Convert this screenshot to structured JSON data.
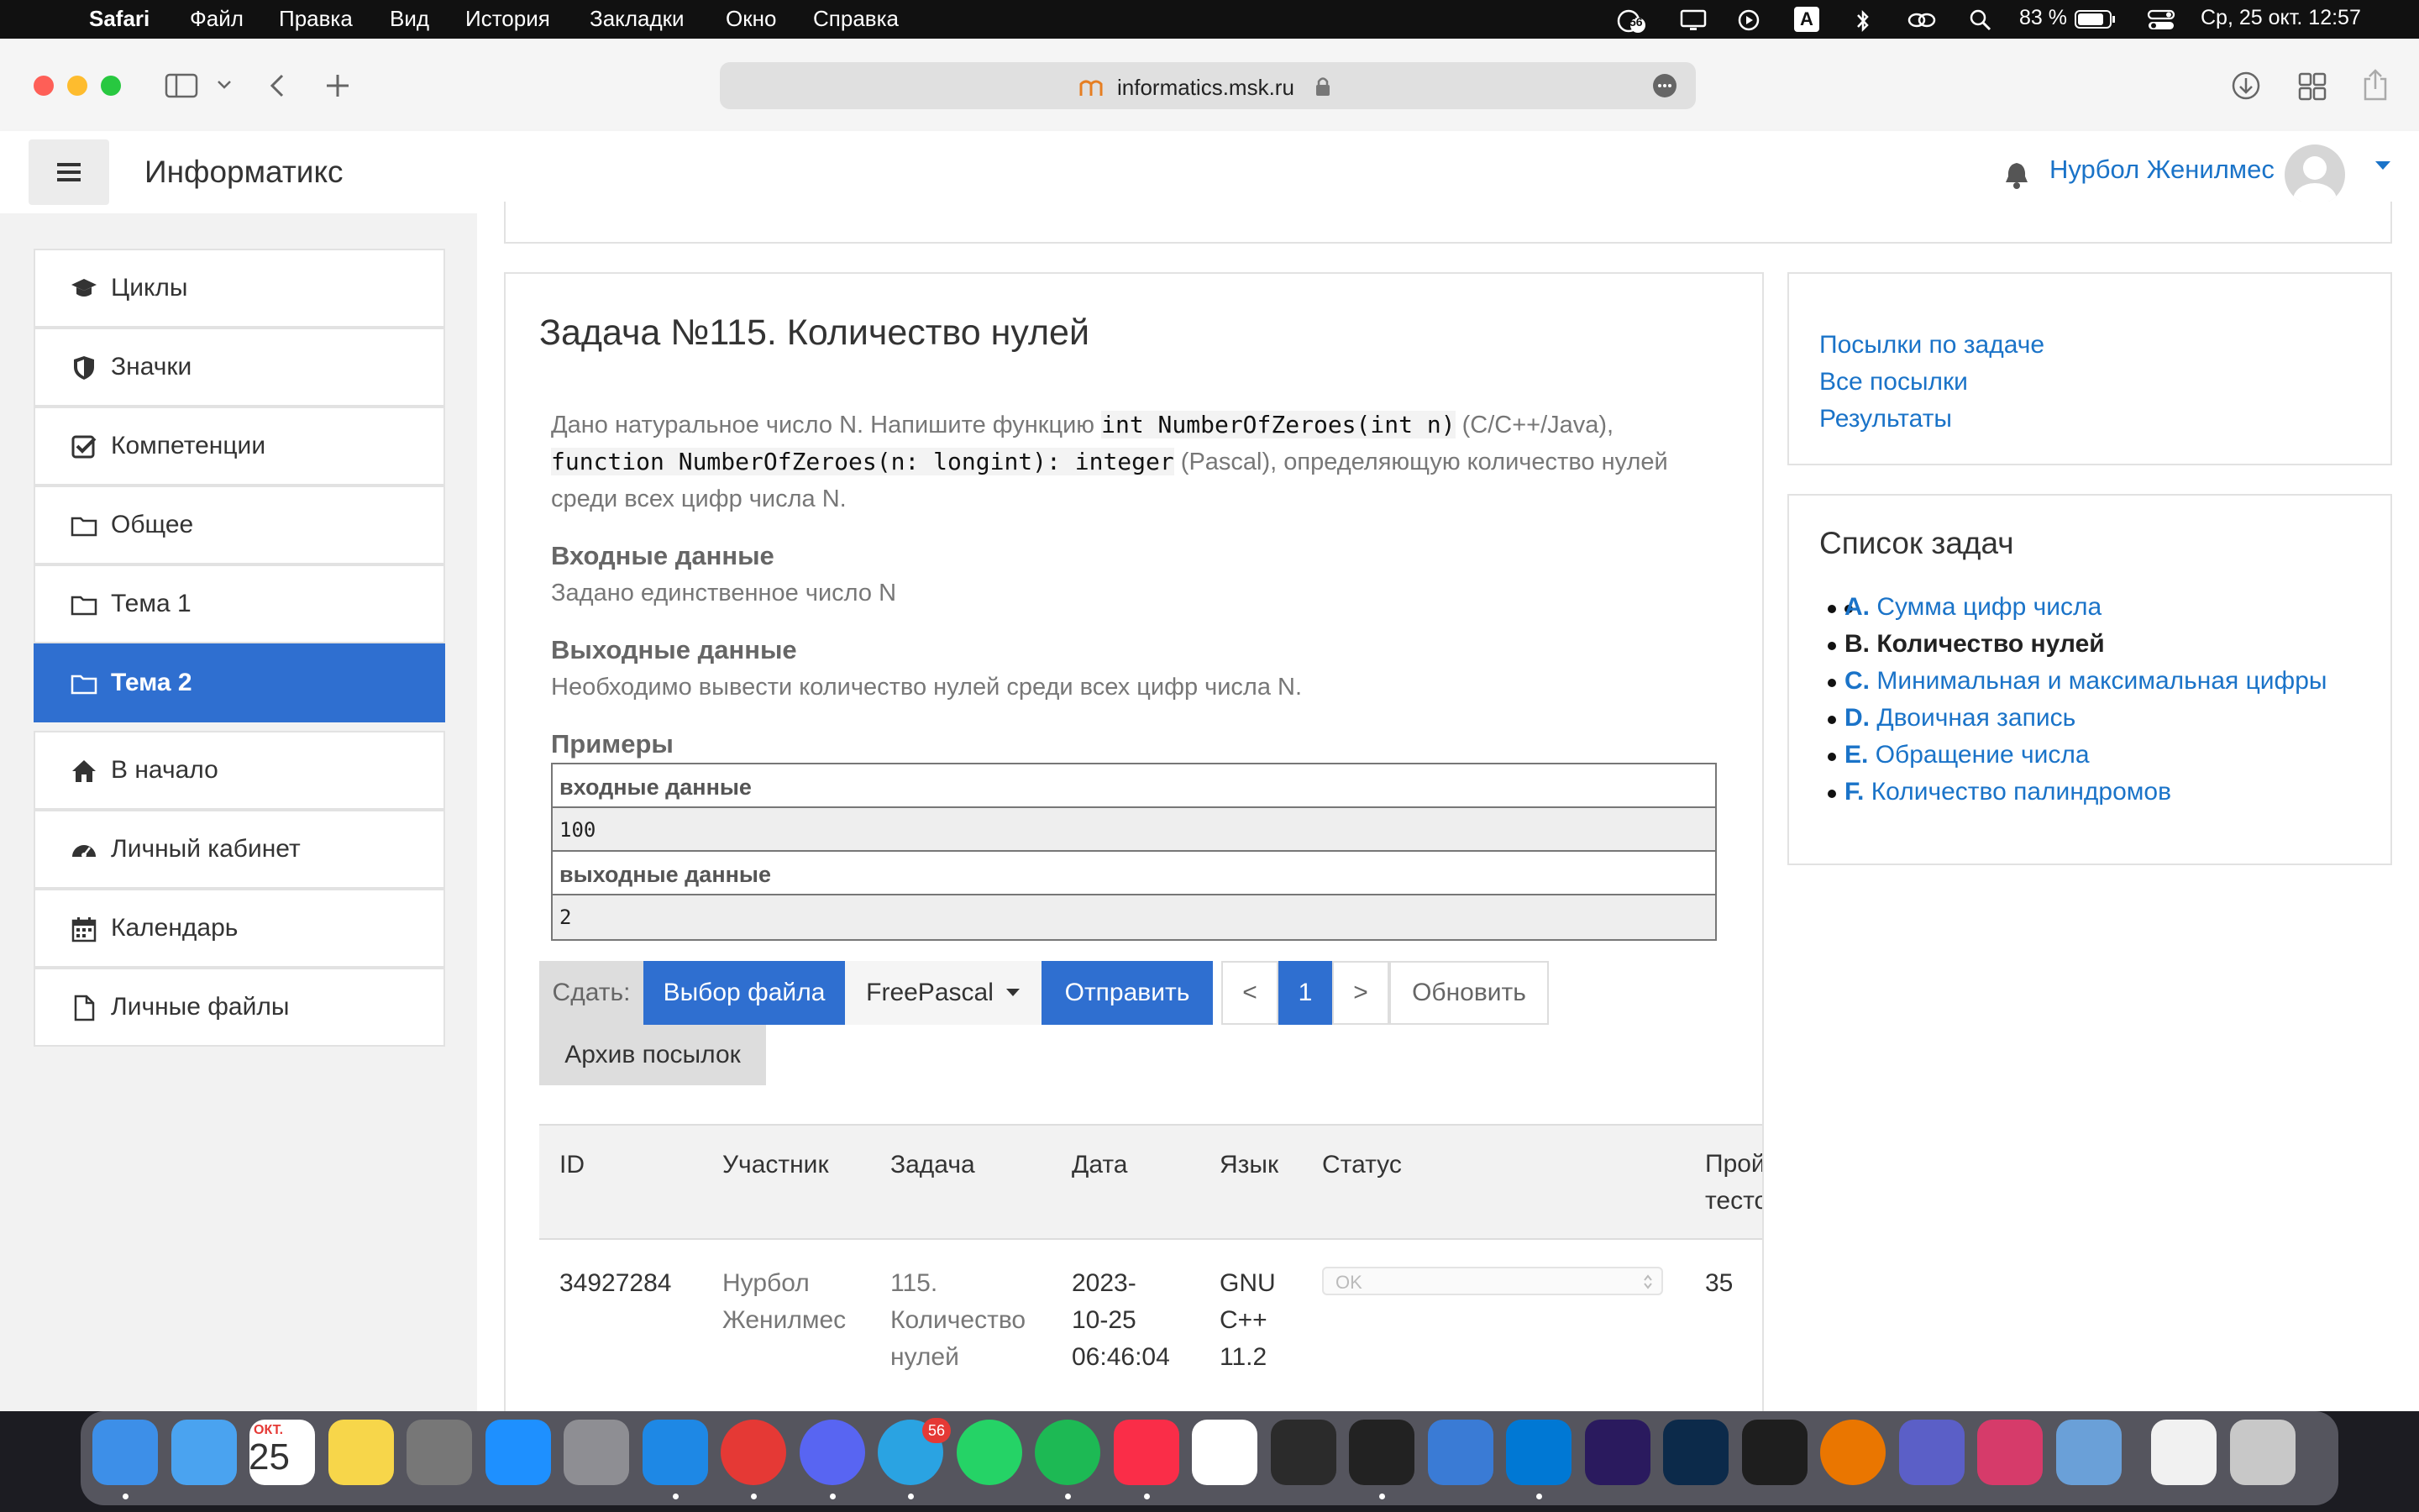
{
  "menubar": {
    "app": "Safari",
    "items": [
      "Файл",
      "Правка",
      "Вид",
      "История",
      "Закладки",
      "Окно",
      "Справка"
    ],
    "notif_count": "56",
    "battery": "83 %",
    "datetime": "Ср, 25 окт.  12:57",
    "input_lang": "A"
  },
  "browser": {
    "url": "informatics.msk.ru"
  },
  "site": {
    "brand": "Информатикс",
    "user_name": "Нурбол Женилмес"
  },
  "sidebar": {
    "items": [
      {
        "label": "Циклы",
        "icon": "graduation-cap-icon"
      },
      {
        "label": "Значки",
        "icon": "shield-icon"
      },
      {
        "label": "Компетенции",
        "icon": "checkbox-icon"
      },
      {
        "label": "Общее",
        "icon": "folder-icon"
      },
      {
        "label": "Тема 1",
        "icon": "folder-icon"
      },
      {
        "label": "Тема 2",
        "icon": "folder-icon",
        "active": true
      }
    ],
    "nav": [
      {
        "label": "В начало",
        "icon": "home-icon"
      },
      {
        "label": "Личный кабинет",
        "icon": "dashboard-icon"
      },
      {
        "label": "Календарь",
        "icon": "calendar-icon"
      },
      {
        "label": "Личные файлы",
        "icon": "file-icon"
      }
    ]
  },
  "task": {
    "title": "Задача №115. Количество нулей",
    "desc_part1": "Дано натуральное число N. Напишите функцию ",
    "code1": "int NumberOfZeroes(int n)",
    "desc_part2": " (C/C++/Java),",
    "code2": "function NumberOfZeroes(n: longint): integer",
    "desc_part3": " (Pascal), определяющую количество нулей",
    "desc_part4": "среди всех цифр числа N.",
    "input_heading": "Входные данные",
    "input_text": "Задано единственное число N",
    "output_heading": "Выходные данные",
    "output_text": "Необходимо вывести количество нулей среди всех цифр числа N.",
    "examples_heading": "Примеры",
    "example_input_label": "входные данные",
    "example_input": "100",
    "example_output_label": "выходные данные",
    "example_output": "2"
  },
  "submit": {
    "label": "Сдать:",
    "choose_file": "Выбор файла",
    "language": "FreePascal",
    "send": "Отправить",
    "prev": "<",
    "page": "1",
    "next": ">",
    "refresh": "Обновить",
    "archive": "Архив посылок"
  },
  "submissions": {
    "headers": [
      "ID",
      "Участник",
      "Задача",
      "Дата",
      "Язык",
      "Статус",
      "Прой тесто"
    ],
    "row": {
      "id": "34927284",
      "user_1": "Нурбол",
      "user_2": "Женилмес",
      "task_1": "115.",
      "task_2": "Количество",
      "task_3": "нулей",
      "date_1": "2023-",
      "date_2": "10-25",
      "date_3": "06:46:04",
      "lang_1": "GNU",
      "lang_2": "C++",
      "lang_3": "11.2",
      "status": "OK",
      "tests": "35"
    }
  },
  "right_links": [
    "Посылки по задаче",
    "Все посылки",
    "Результаты"
  ],
  "task_list": {
    "title": "Список задач",
    "items": [
      {
        "letter": "A.",
        "name": "Сумма цифр числа",
        "current": false
      },
      {
        "letter": "B.",
        "name": "Количество нулей",
        "current": true
      },
      {
        "letter": "C.",
        "name": "Минимальная и максимальная цифры",
        "current": false
      },
      {
        "letter": "D.",
        "name": "Двоичная запись",
        "current": false
      },
      {
        "letter": "E.",
        "name": "Обращение числа",
        "current": false
      },
      {
        "letter": "F.",
        "name": "Количество палиндромов",
        "current": false
      }
    ]
  },
  "dock": {
    "calendar_month": "ОКТ.",
    "calendar_day": "25",
    "telegram_badge": "56",
    "apps": [
      "finder-icon",
      "mail-icon",
      "calendar-icon",
      "notes-icon",
      "calculator-icon",
      "app-store-icon",
      "system-settings-icon",
      "safari-icon",
      "chrome-icon",
      "discord-icon",
      "telegram-icon",
      "whatsapp-icon",
      "spotify-icon",
      "music-icon",
      "notion-icon",
      "activity-monitor-icon",
      "terminal-icon",
      "xcode-icon",
      "vscode-icon",
      "premiere-icon",
      "photoshop-icon",
      "figma-icon",
      "blender-icon",
      "teams-icon",
      "app-icon",
      "preview-icon",
      "documents-icon",
      "trash-icon"
    ]
  }
}
